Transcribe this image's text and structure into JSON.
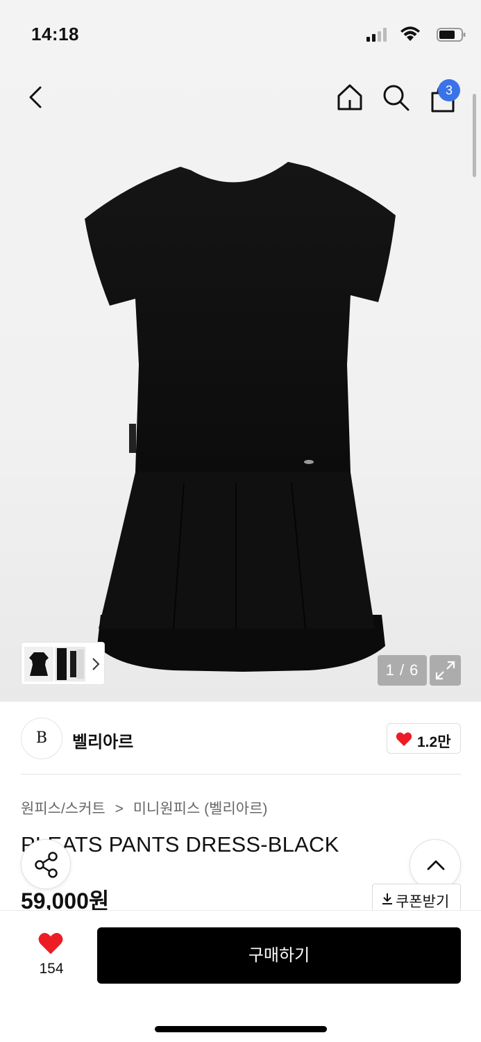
{
  "status_bar": {
    "time": "14:18"
  },
  "nav": {
    "cart_badge": "3"
  },
  "gallery": {
    "counter": "1 / 6"
  },
  "brand": {
    "logo_text": "B",
    "name": "벨리아르",
    "like_count": "1.2만"
  },
  "breadcrumb": {
    "category": "원피스/스커트",
    "separator": ">",
    "subcategory": "미니원피스 (벨리아르)"
  },
  "product": {
    "title": "PLEATS PANTS DRESS-BLACK",
    "price": "59,000원"
  },
  "actions": {
    "coupon_label": "쿠폰받기",
    "wish_count": "154",
    "buy_label": "구매하기"
  },
  "colors": {
    "accent_red": "#ee1c25",
    "badge_blue": "#3a73e8",
    "buy_button": "#000000"
  }
}
